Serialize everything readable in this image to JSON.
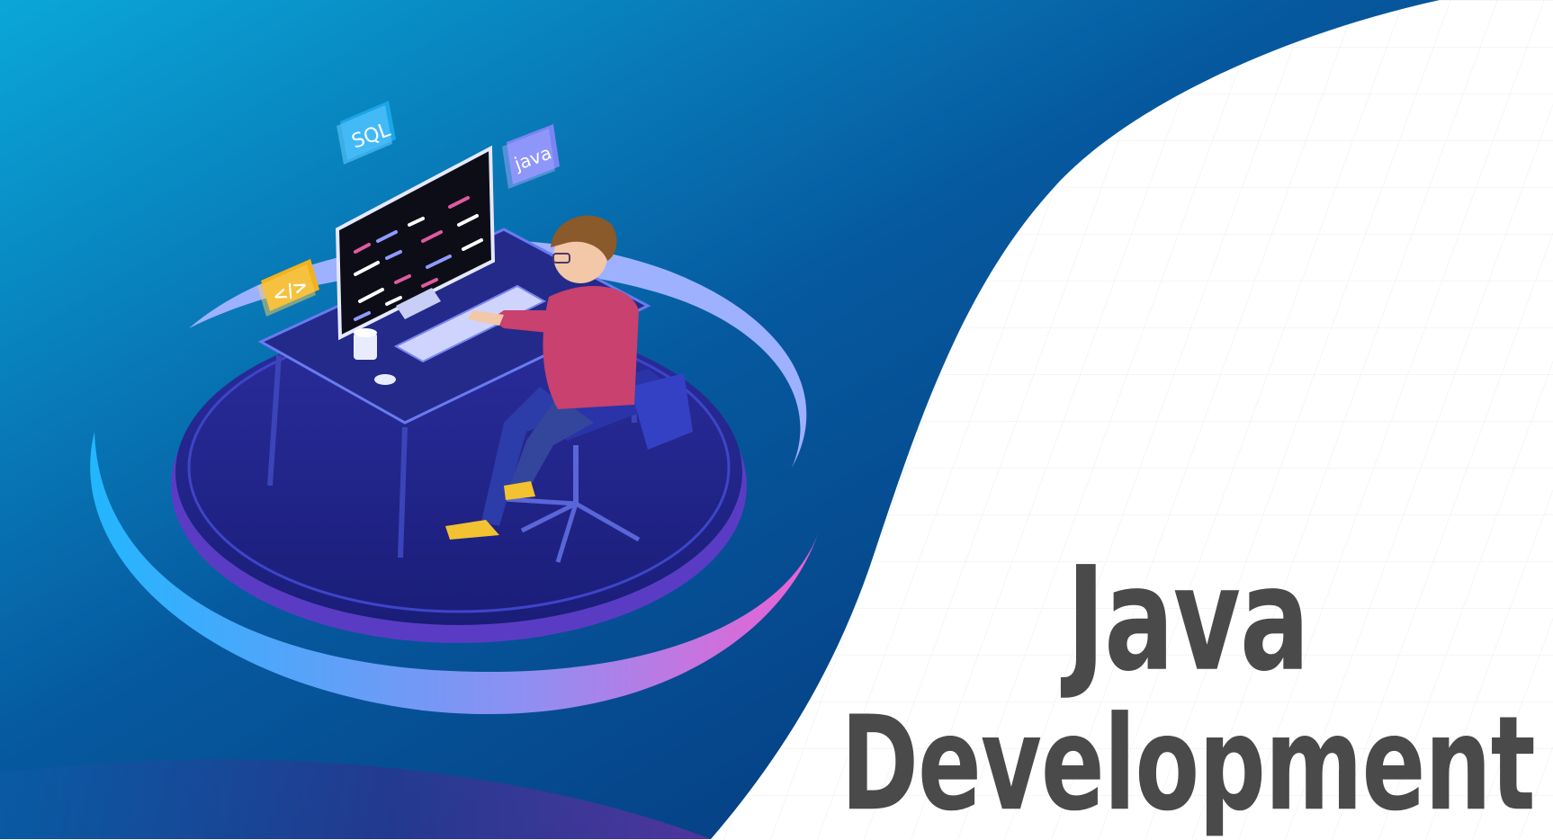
{
  "badges": {
    "sql": "SQL",
    "java": "java",
    "code": "</>"
  },
  "title": {
    "line1": "Java",
    "line2": "Development"
  },
  "colors": {
    "background_dark": "#04357a",
    "background_light": "#0aa0d6",
    "title_text": "#4a4a4a",
    "shirt": "#c8416f",
    "shoe": "#f2c230",
    "ring_light": "#9eb1ff",
    "ring_pink": "#e65fd0"
  }
}
